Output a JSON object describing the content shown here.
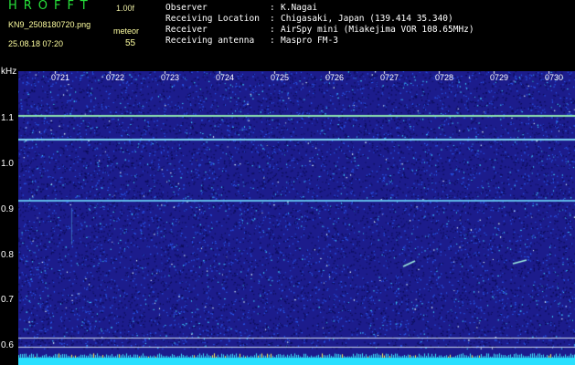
{
  "header": {
    "app_title": "HROFFT",
    "version": "1.00f",
    "filename": "KN9_2508180720.png",
    "mode": "meteor",
    "datetime": "25.08.18 07:20",
    "count": "55"
  },
  "info": [
    {
      "key": "Observer",
      "value": "K.Nagai"
    },
    {
      "key": "Receiving Location",
      "value": "Chigasaki, Japan (139.414 35.340)"
    },
    {
      "key": "Receiver",
      "value": "AirSpy mini (Miakejima VOR 108.65MHz)"
    },
    {
      "key": "Receiving antenna",
      "value": "Maspro FM-3"
    }
  ],
  "spectrogram": {
    "y_unit": "kHz",
    "y_ticks": [
      "1.1",
      "1.0",
      "0.9",
      "0.8",
      "0.7",
      "0.6"
    ],
    "x_ticks": [
      "0721",
      "0722",
      "0723",
      "0724",
      "0725",
      "0726",
      "0727",
      "0728",
      "0729",
      "0730"
    ],
    "background_color": "#1c1c8c",
    "carrier_color": "#8fe6b0",
    "noise_band_color": "#29e0ff"
  }
}
